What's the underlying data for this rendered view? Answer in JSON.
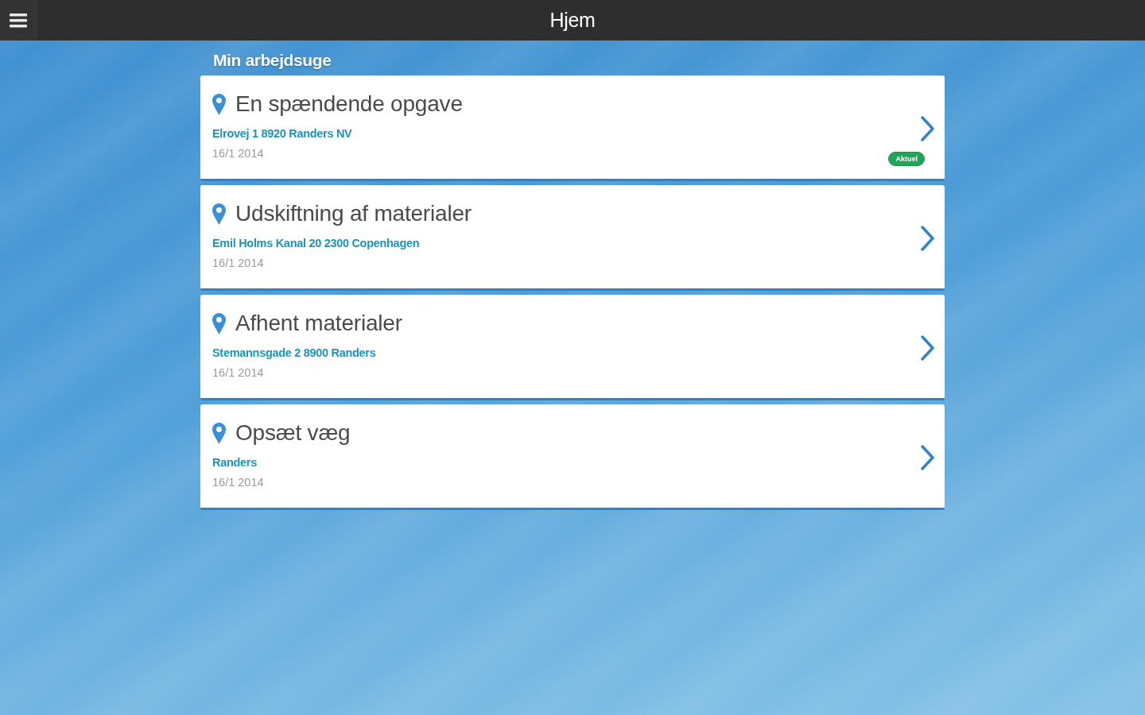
{
  "header": {
    "title": "Hjem"
  },
  "section_title": "Min arbejdsuge",
  "tasks": [
    {
      "title": "En spændende opgave",
      "address": "Elrovej 1 8920 Randers NV",
      "date": "16/1 2014",
      "badge": "Aktuel"
    },
    {
      "title": "Udskiftning af materialer",
      "address": "Emil Holms Kanal 20 2300 Copenhagen",
      "date": "16/1 2014"
    },
    {
      "title": "Afhent materialer",
      "address": "Stemannsgade 2 8900 Randers",
      "date": "16/1 2014"
    },
    {
      "title": "Opsæt væg",
      "address": "Randers",
      "date": "16/1 2014"
    }
  ]
}
